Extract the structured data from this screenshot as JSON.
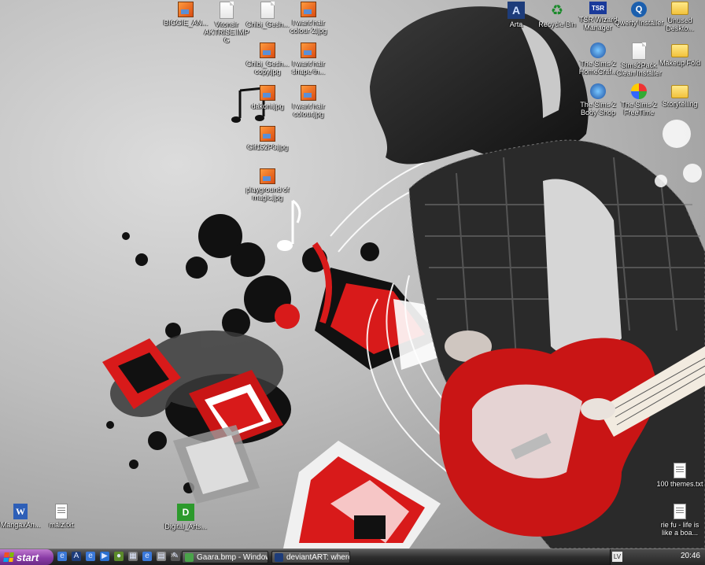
{
  "desktop_icons": {
    "biggie": "BIGGIE_AN...",
    "vitonsir": "Vitonsir AKTRISE.IMPG",
    "chibi_gesh": "Chibi_Gesh...",
    "hair_colour2": "I want hair colour 2.jpg",
    "chibi_copy": "Chibi_Gesh... copy.jpg",
    "hair_shape": "I want hair shape th...",
    "dakoni": "dakoni.jpg",
    "hair_colour": "I want hair colour.jpg",
    "gif": "Gif152P3.jpg",
    "playground": "playground of magic.jpg",
    "arta": "Arta",
    "recycle": "Recycle Bin",
    "tsr_wizard": "TSR Wizard Manager",
    "qwerty": "Qwerty Installer",
    "unused_folder": "Unused Deskto...",
    "sims_homecraft": "The Sims 2 HomeCraf...",
    "sims_clean": "Sims2Pack Clean Installer",
    "makeup_folder": "Makeup Fold",
    "body_shop": "The Sims 2 Body Shop",
    "sims_freetime": "The Sims 2 FreeTime",
    "storytelling": "Storytelling",
    "themes_txt": "100 themes.txt",
    "riefu": "rie fu - life is like a boa...",
    "mangax": "MangaxAn...",
    "malz": "malz.txt",
    "digital": "Digital_Arts..."
  },
  "taskbar": {
    "start_label": "start",
    "tasks": [
      {
        "label": "Gaara.bmp - Window..."
      },
      {
        "label": "deviantART: where A..."
      }
    ],
    "lang": "LV",
    "clock": "20:46"
  },
  "colors": {
    "accent_red": "#d81a1a",
    "start_purple": "#8a3ca6",
    "taskbar": "#2e2e2e"
  }
}
